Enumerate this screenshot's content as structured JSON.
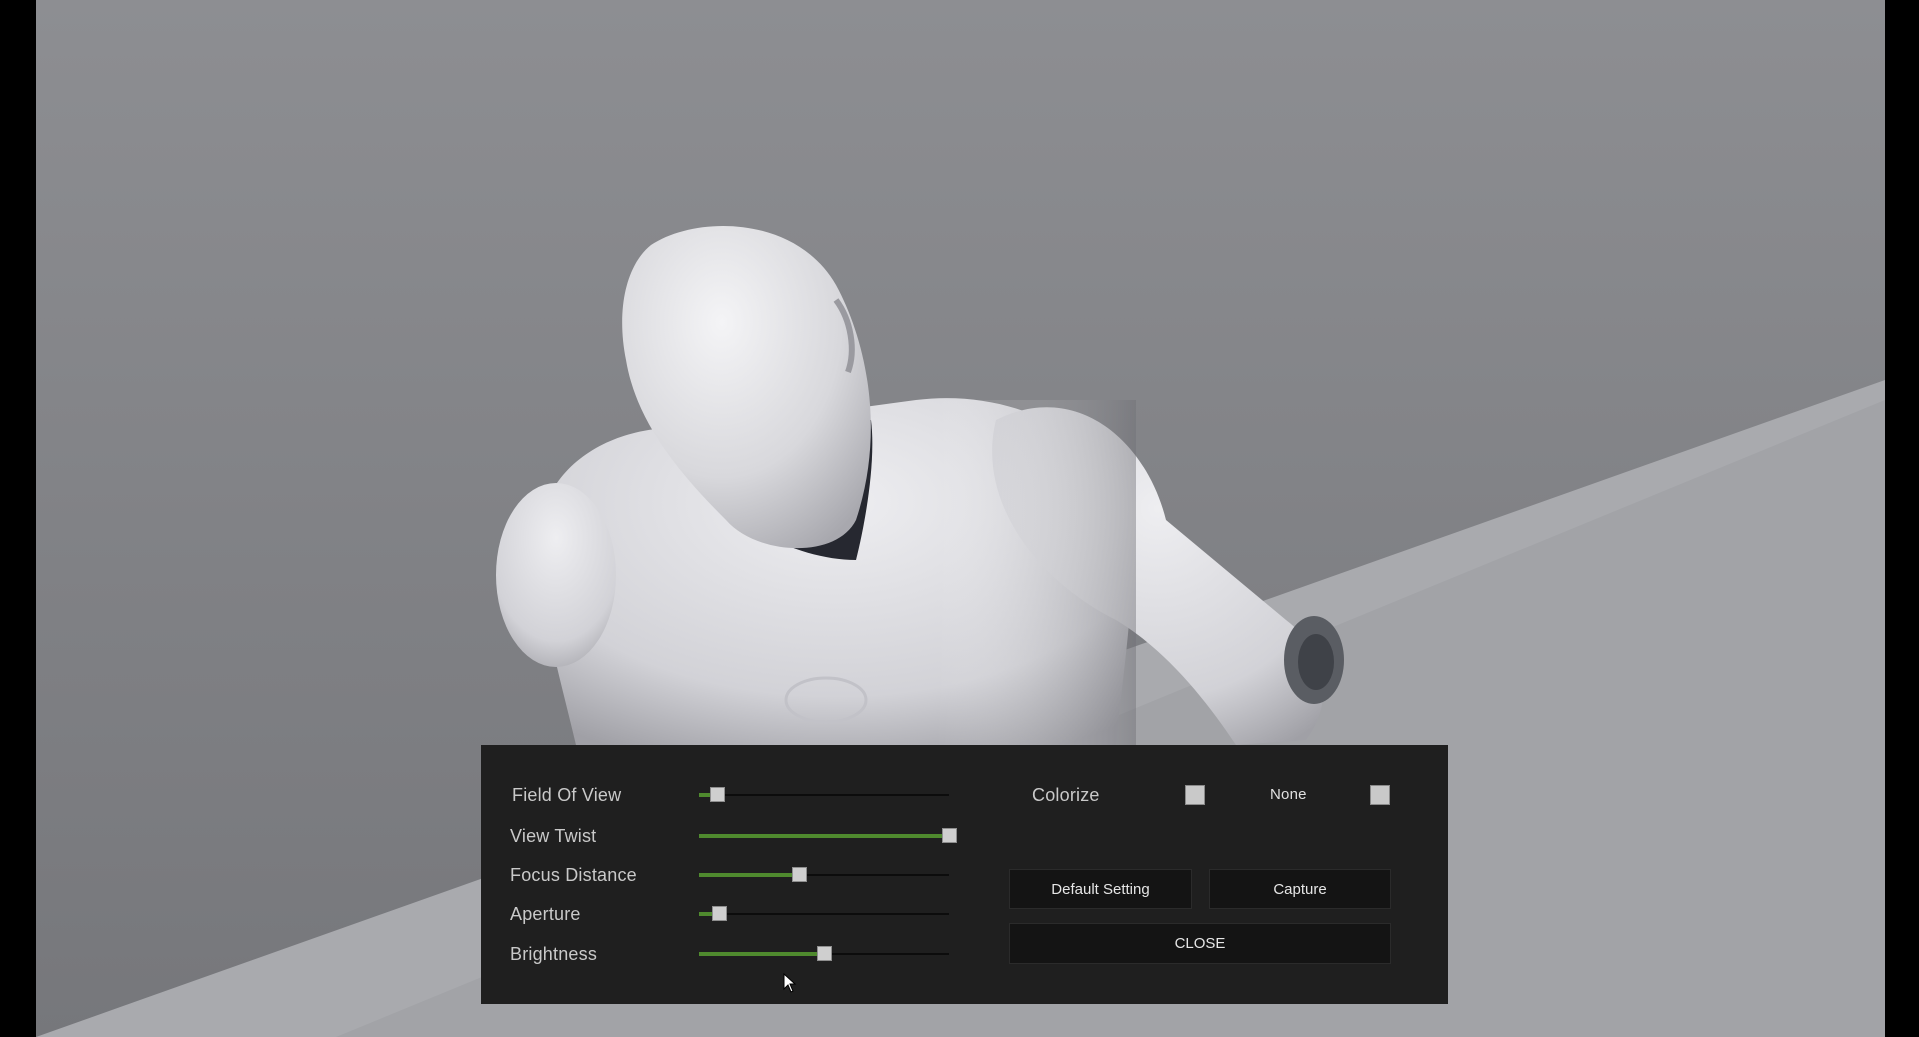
{
  "viewport": {
    "scene_description_icon": "robot-mannequin-icon"
  },
  "photo_mode": {
    "sliders": [
      {
        "label": "Field Of View",
        "value": 0.07
      },
      {
        "label": "View Twist",
        "value": 1.0
      },
      {
        "label": "Focus Distance",
        "value": 0.4
      },
      {
        "label": "Aperture",
        "value": 0.08
      },
      {
        "label": "Brightness",
        "value": 0.5
      }
    ],
    "colorize": {
      "label": "Colorize",
      "checked": false
    },
    "none": {
      "label": "None",
      "checked": false
    },
    "buttons": {
      "default_setting": "Default Setting",
      "capture": "Capture",
      "close": "CLOSE"
    }
  },
  "colors": {
    "panel_bg": "#1f1f1f",
    "slider_fill": "#4f8a2e",
    "button_bg": "#141414"
  }
}
